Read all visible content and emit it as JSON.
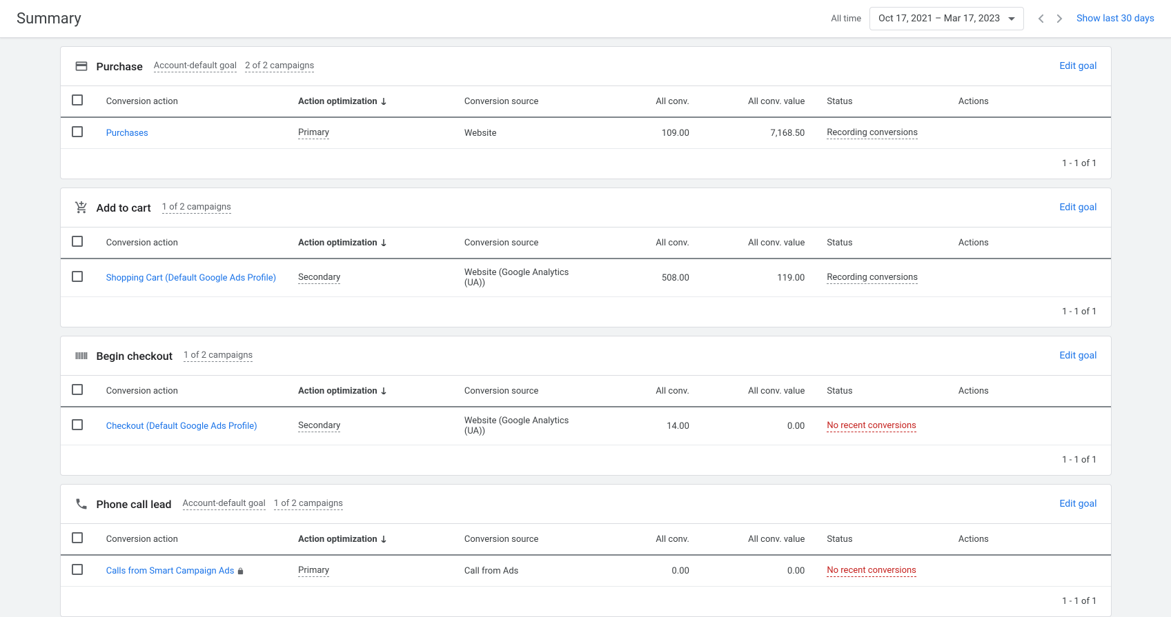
{
  "header": {
    "title": "Summary",
    "all_time": "All time",
    "date_range": "Oct 17, 2021 – Mar 17, 2023",
    "show_last": "Show last 30 days"
  },
  "columns": {
    "conversion_action": "Conversion action",
    "action_optimization": "Action optimization",
    "conversion_source": "Conversion source",
    "all_conv": "All conv.",
    "all_conv_value": "All conv. value",
    "status": "Status",
    "actions": "Actions"
  },
  "goals": [
    {
      "icon": "credit-card",
      "title": "Purchase",
      "badges": [
        "Account-default goal",
        "2 of 2 campaigns"
      ],
      "edit": "Edit goal",
      "rows": [
        {
          "name": "Purchases",
          "locked": false,
          "opt": "Primary",
          "source": "Website",
          "conv": "109.00",
          "value": "7,168.50",
          "status": "Recording conversions",
          "status_type": "ok"
        }
      ],
      "pagination": "1 - 1 of 1"
    },
    {
      "icon": "add-cart",
      "title": "Add to cart",
      "badges": [
        "1 of 2 campaigns"
      ],
      "edit": "Edit goal",
      "rows": [
        {
          "name": "Shopping Cart (Default Google Ads Profile)",
          "locked": false,
          "opt": "Secondary",
          "source": "Website (Google Analytics (UA))",
          "conv": "508.00",
          "value": "119.00",
          "status": "Recording conversions",
          "status_type": "ok"
        }
      ],
      "pagination": "1 - 1 of 1"
    },
    {
      "icon": "barcode",
      "title": "Begin checkout",
      "badges": [
        "1 of 2 campaigns"
      ],
      "edit": "Edit goal",
      "rows": [
        {
          "name": "Checkout (Default Google Ads Profile)",
          "locked": false,
          "opt": "Secondary",
          "source": "Website (Google Analytics (UA))",
          "conv": "14.00",
          "value": "0.00",
          "status": "No recent conversions",
          "status_type": "warn"
        }
      ],
      "pagination": "1 - 1 of 1"
    },
    {
      "icon": "phone",
      "title": "Phone call lead",
      "badges": [
        "Account-default goal",
        "1 of 2 campaigns"
      ],
      "edit": "Edit goal",
      "rows": [
        {
          "name": "Calls from Smart Campaign Ads",
          "locked": true,
          "opt": "Primary",
          "source": "Call from Ads",
          "conv": "0.00",
          "value": "0.00",
          "status": "No recent conversions",
          "status_type": "warn"
        }
      ],
      "pagination": "1 - 1 of 1"
    }
  ]
}
